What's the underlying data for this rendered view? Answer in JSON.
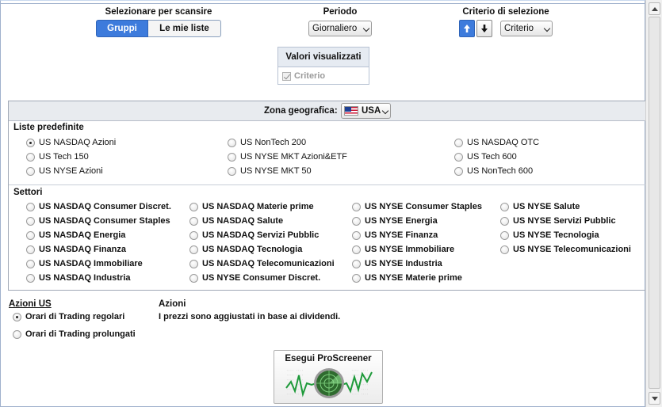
{
  "scan": {
    "title": "Selezionare per scansire",
    "tab_groups": "Gruppi",
    "tab_my_lists": "Le mie liste"
  },
  "period": {
    "title": "Periodo",
    "value": "Giornaliero"
  },
  "criteria": {
    "title": "Criterio di selezione",
    "value": "Criterio"
  },
  "displayed_values": {
    "title": "Valori visualizzati",
    "criterion_label": "Criterio"
  },
  "geo": {
    "label": "Zona geografica:",
    "value": "USA"
  },
  "predefined_lists": {
    "title": "Liste predefinite",
    "items": [
      "US NASDAQ Azioni",
      "US NonTech 200",
      "US NASDAQ OTC",
      "US Tech 150",
      "US NYSE MKT Azioni&ETF",
      "US Tech 600",
      "US NYSE Azioni",
      "US NYSE MKT 50",
      "US NonTech 600"
    ],
    "selected_index": 0
  },
  "sectors": {
    "title": "Settori",
    "columns": [
      [
        "US NASDAQ Consumer Discret.",
        "US NASDAQ Consumer Staples",
        "US NASDAQ Energia",
        "US NASDAQ Finanza",
        "US NASDAQ Immobiliare",
        "US NASDAQ Industria"
      ],
      [
        "US NASDAQ Materie prime",
        "US NASDAQ Salute",
        "US NASDAQ Servizi Pubblic",
        "US NASDAQ Tecnologia",
        "US NASDAQ Telecomunicazioni",
        "US NYSE Consumer Discret."
      ],
      [
        "US NYSE Consumer Staples",
        "US NYSE Energia",
        "US NYSE Finanza",
        "US NYSE Immobiliare",
        "US NYSE Industria",
        "US NYSE Materie prime"
      ],
      [
        "US NYSE Salute",
        "US NYSE Servizi Pubblic",
        "US NYSE Tecnologia",
        "US NYSE Telecomunicazioni"
      ]
    ]
  },
  "us_stocks": {
    "title": "Azioni US",
    "regular": "Orari di Trading regolari",
    "extended": "Orari di Trading prolungati"
  },
  "stocks_note": {
    "title": "Azioni",
    "text": "I prezzi sono aggiustati in base ai dividendi."
  },
  "run_button": {
    "label": "Esegui ProScreener"
  },
  "colors": {
    "accent": "#3d7bdc",
    "background": "#c9d9ef"
  }
}
